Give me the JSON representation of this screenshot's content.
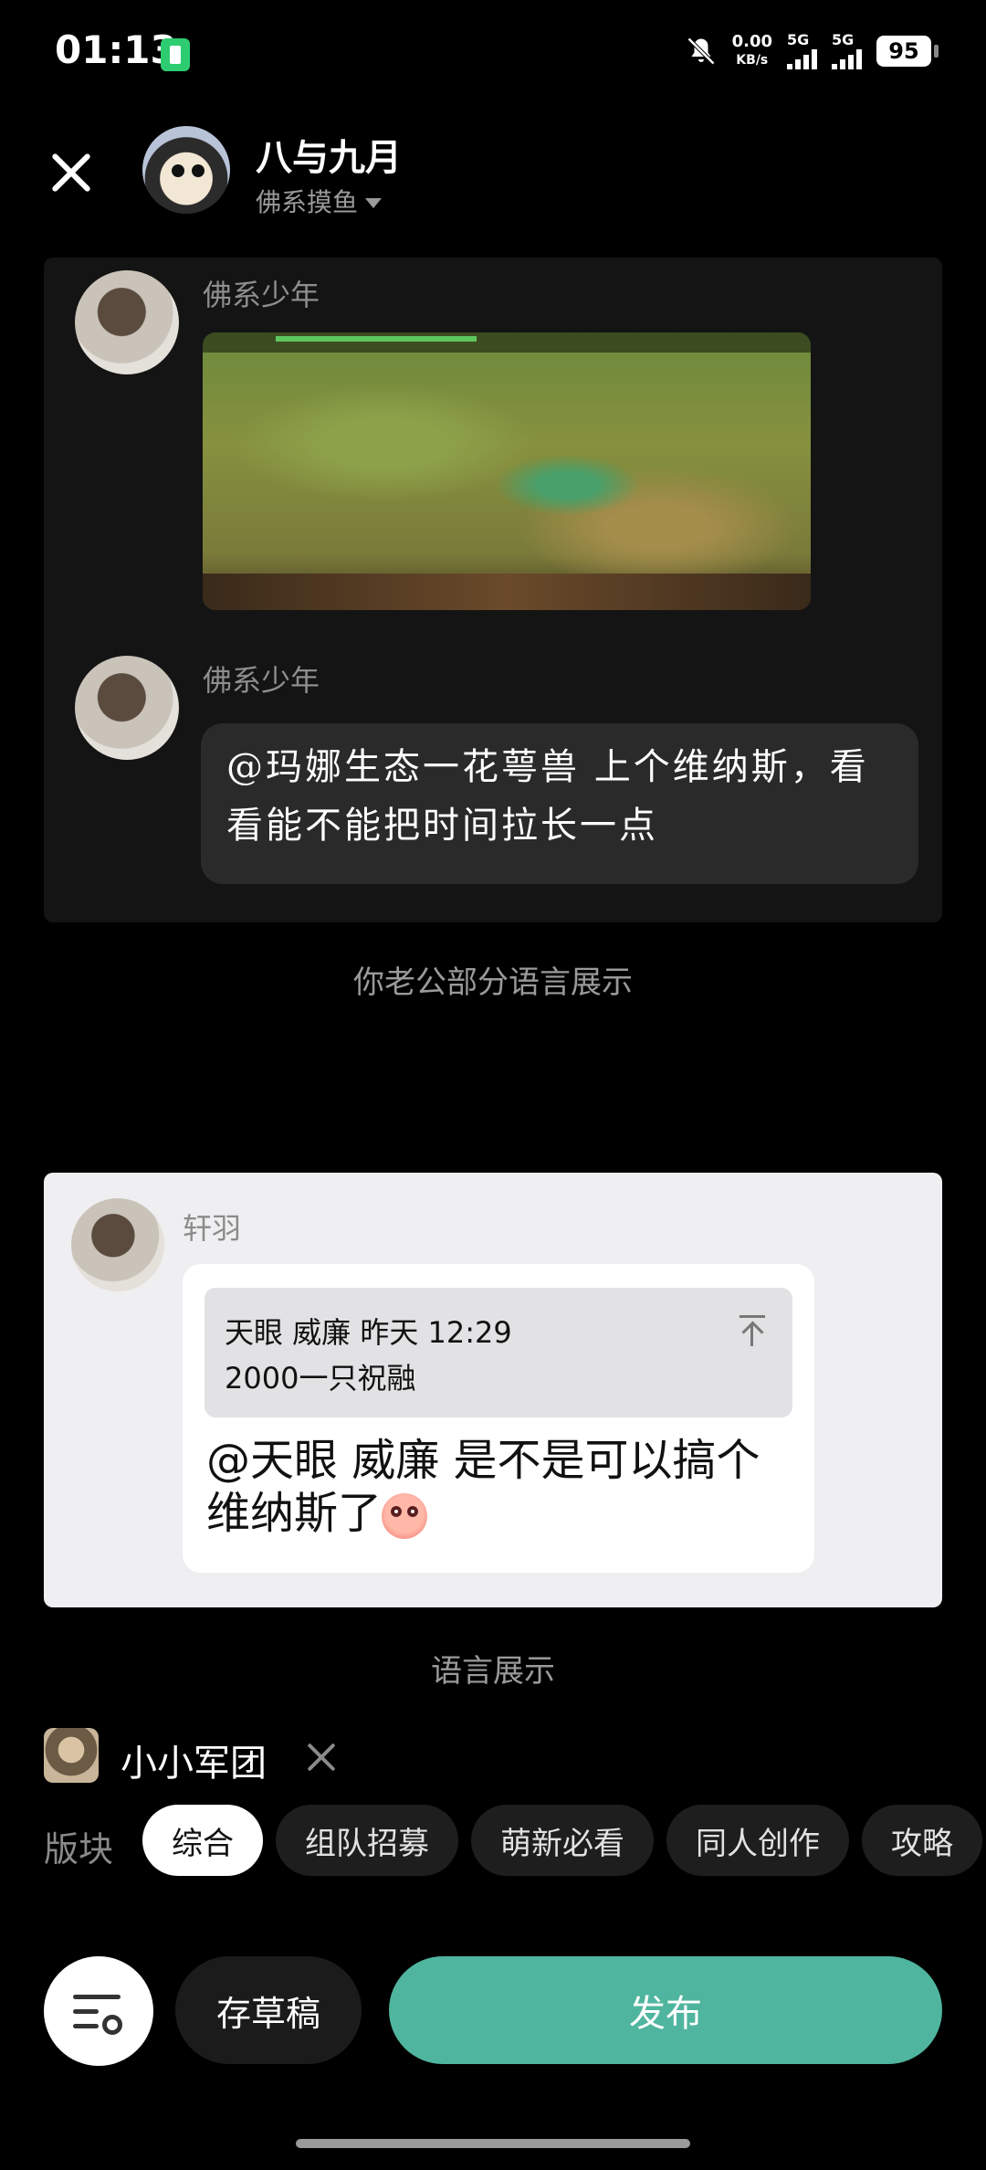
{
  "status_bar": {
    "time": "01:13",
    "net_speed_value": "0.00",
    "net_speed_unit": "KB/s",
    "sim1": "5G",
    "sim2": "5G",
    "battery": "95"
  },
  "header": {
    "title": "八与九月",
    "subtitle": "佛系摸鱼"
  },
  "preview1": {
    "messages": [
      {
        "sender": "佛系少年",
        "type": "image"
      },
      {
        "sender": "佛系少年",
        "type": "text",
        "text": "@玛娜生态一花萼兽 上个维纳斯，看看能不能把时间拉长一点"
      }
    ],
    "caption": "你老公部分语言展示"
  },
  "preview2": {
    "sender": "轩羽",
    "quote_line1": "天眼 威廉 昨天 12:29",
    "quote_line2": "2000一只祝融",
    "message": "@天眼 威廉 是不是可以搞个维纳斯了",
    "caption": "语言展示"
  },
  "game_tag": {
    "name": "小小军团"
  },
  "sections": {
    "label": "版块",
    "chips": [
      "综合",
      "组队招募",
      "萌新必看",
      "同人创作",
      "攻略"
    ],
    "active": 0
  },
  "bottom": {
    "draft": "存草稿",
    "publish": "发布"
  },
  "colors": {
    "publish": "#4fb59e",
    "background": "#000000"
  }
}
